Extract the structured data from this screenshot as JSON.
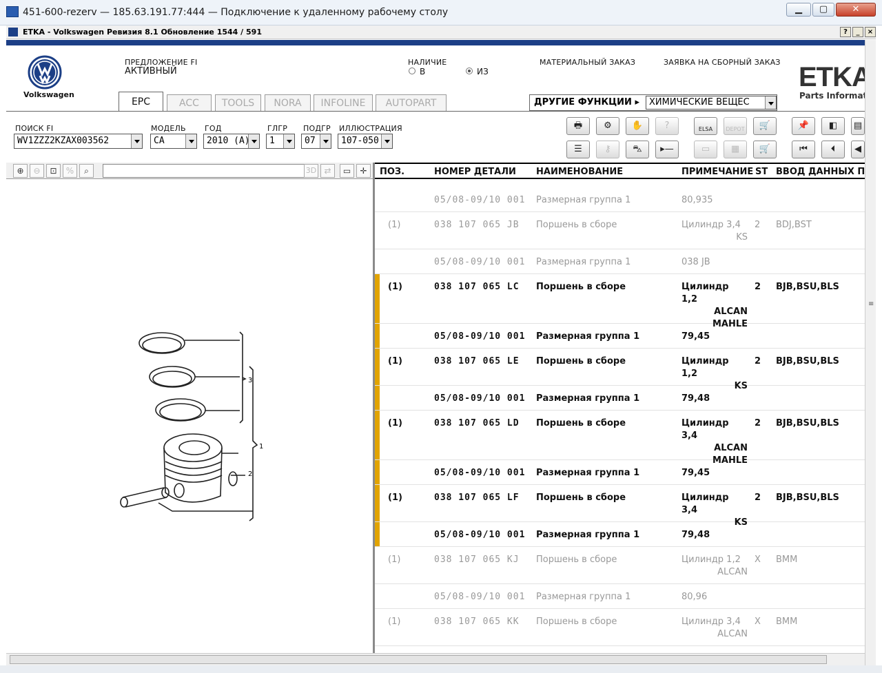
{
  "rdp": {
    "title": "451-600-rezerv — 185.63.191.77:444 — Подключение к удаленному рабочему столу",
    "min": "▁",
    "max": "▢",
    "close": "✕"
  },
  "app": {
    "title": "ETKA - Volkswagen Ревизия 8.1 Обновление 1544 / 591",
    "help": "?",
    "min": "_",
    "close": "×"
  },
  "brand": {
    "vw_label": "Volkswagen",
    "etka_logo": "ETKA",
    "etka_sub": "Parts Informati"
  },
  "header": {
    "fi_label": "ПРЕДЛОЖЕНИЕ FI",
    "fi_value": "АКТИВНЫЙ",
    "availability_label": "НАЛИЧИЕ",
    "radio_v": "В",
    "radio_iz": "ИЗ",
    "material_order": "МАТЕРИАЛЬНЫЙ ЗАКАЗ",
    "collect_order": "ЗАЯВКА НА СБОРНЫЙ ЗАКАЗ",
    "other_functions": "ДРУГИЕ ФУНКЦИИ ▸",
    "chemicals": "ХИМИЧЕСКИЕ ВЕЩЕС"
  },
  "tabs": [
    "EPC",
    "ACC",
    "TOOLS",
    "NORA",
    "INFOLINE",
    "AUTOPART"
  ],
  "filters": {
    "search_label": "ПОИСК FI",
    "search_value": "WV1ZZZ2KZAX003562",
    "model_label": "МОДЕЛЬ",
    "model_value": "CA",
    "year_label": "ГОД",
    "year_value": "2010 (A)",
    "mg_label": "ГЛГР",
    "mg_value": "1",
    "sg_label": "ПОДГР",
    "sg_value": "07",
    "ill_label": "ИЛЛЮСТРАЦИЯ",
    "ill_value": "107-050"
  },
  "toolbar": {
    "elsa": "ELSA",
    "depot": "DEPOT"
  },
  "left_toolbar": {
    "three_d": "3D"
  },
  "illustration": {
    "callout_3": "3",
    "callout_1": "1",
    "callout_2": "2"
  },
  "table": {
    "headers": {
      "pos": "ПОЗ.",
      "part": "НОМЕР ДЕТАЛИ",
      "name": "НАИМЕНОВАНИЕ",
      "note": "ПРИМЕЧАНИЕ",
      "st": "ST",
      "input": "ВВОД ДАННЫХ ПО I"
    },
    "rows": [
      {
        "pos": "",
        "part": "05/08-09/10 001",
        "name": "Размерная группа 1",
        "note1": "80,935",
        "note2": "",
        "note3": "",
        "st": "",
        "input": ""
      },
      {
        "pos": "(1)",
        "part": "038 107 065 JB",
        "name": "Поршень в сборе",
        "note1": "Цилиндр 3,4",
        "note2": "KS",
        "note3": "",
        "st": "2",
        "input": "BDJ,BST"
      },
      {
        "pos": "",
        "part": "05/08-09/10 001",
        "name": "Размерная группа 1",
        "note1": "038 JB",
        "note2": "",
        "note3": "",
        "st": "",
        "input": ""
      },
      {
        "pos": "(1)",
        "part": "038 107 065 LC",
        "name": "Поршень в сборе",
        "note1": "Цилиндр 1,2",
        "note2": "ALCAN",
        "note3": "MAHLE",
        "st": "2",
        "input": "BJB,BSU,BLS"
      },
      {
        "pos": "",
        "part": "05/08-09/10 001",
        "name": "Размерная группа 1",
        "note1": "79,45",
        "note2": "",
        "note3": "",
        "st": "",
        "input": ""
      },
      {
        "pos": "(1)",
        "part": "038 107 065 LE",
        "name": "Поршень в сборе",
        "note1": "Цилиндр 1,2",
        "note2": "KS",
        "note3": "",
        "st": "2",
        "input": "BJB,BSU,BLS"
      },
      {
        "pos": "",
        "part": "05/08-09/10 001",
        "name": "Размерная группа 1",
        "note1": "79,48",
        "note2": "",
        "note3": "",
        "st": "",
        "input": ""
      },
      {
        "pos": "(1)",
        "part": "038 107 065 LD",
        "name": "Поршень в сборе",
        "note1": "Цилиндр 3,4",
        "note2": "ALCAN",
        "note3": "MAHLE",
        "st": "2",
        "input": "BJB,BSU,BLS"
      },
      {
        "pos": "",
        "part": "05/08-09/10 001",
        "name": "Размерная группа 1",
        "note1": "79,45",
        "note2": "",
        "note3": "",
        "st": "",
        "input": ""
      },
      {
        "pos": "(1)",
        "part": "038 107 065 LF",
        "name": "Поршень в сборе",
        "note1": "Цилиндр 3,4",
        "note2": "KS",
        "note3": "",
        "st": "2",
        "input": "BJB,BSU,BLS"
      },
      {
        "pos": "",
        "part": "05/08-09/10 001",
        "name": "Размерная группа 1",
        "note1": "79,48",
        "note2": "",
        "note3": "",
        "st": "",
        "input": ""
      },
      {
        "pos": "(1)",
        "part": "038 107 065 KJ",
        "name": "Поршень в сборе",
        "note1": "Цилиндр 1,2",
        "note2": "ALCAN",
        "note3": "",
        "st": "X",
        "input": "BMM"
      },
      {
        "pos": "",
        "part": "05/08-09/10 001",
        "name": "Размерная группа 1",
        "note1": "80,96",
        "note2": "",
        "note3": "",
        "st": "",
        "input": ""
      },
      {
        "pos": "(1)",
        "part": "038 107 065 KK",
        "name": "Поршень в сборе",
        "note1": "Цилиндр 3,4",
        "note2": "ALCAN",
        "note3": "",
        "st": "X",
        "input": "BMM"
      }
    ]
  },
  "colors": {
    "highlight_marker": "#e2a400",
    "brand_blue": "#1c3f86"
  }
}
